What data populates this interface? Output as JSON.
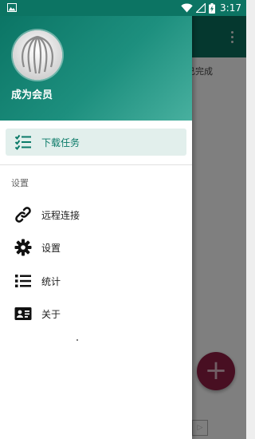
{
  "status_bar": {
    "time": "3:17",
    "left_icon": "image-icon",
    "icons": [
      "wifi-icon",
      "signal-icon",
      "battery-charging-icon"
    ]
  },
  "background_app": {
    "status_text": "已完成",
    "fab_symbol": "+",
    "ad_symbol": "▷"
  },
  "drawer": {
    "header": {
      "member_label": "成为会员"
    },
    "items": [
      {
        "label": "下载任务",
        "icon": "download-tasks-icon",
        "selected": true
      },
      {
        "label": "远程连接",
        "icon": "link-icon"
      },
      {
        "label": "设置",
        "icon": "gear-icon"
      },
      {
        "label": "统计",
        "icon": "list-icon"
      },
      {
        "label": "关于",
        "icon": "contact-card-icon"
      }
    ],
    "section_label": "设置"
  },
  "colors": {
    "primary": "#0a6b5b",
    "accent": "#0a7a68",
    "selected_bg": "#e2efec",
    "fab": "#8a1d42"
  }
}
